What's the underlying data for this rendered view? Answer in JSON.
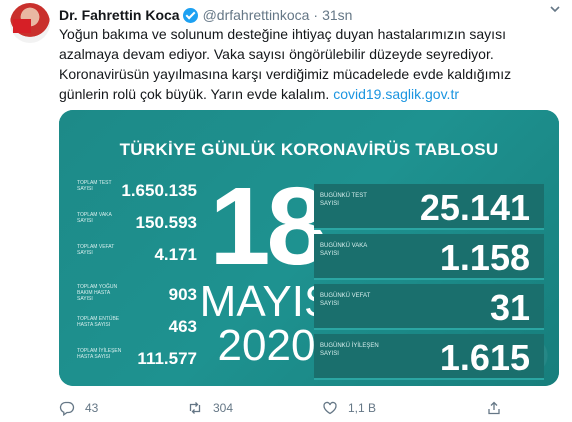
{
  "tweet": {
    "author_name": "Dr. Fahrettin Koca",
    "handle": "@drfahrettinkoca",
    "separator": "·",
    "time": "31sn",
    "text_lines": [
      "Yoğun bakıma ve solunum desteğine ihtiyaç duyan hastalarımızın sayısı",
      "azalmaya devam ediyor. Vaka sayısı öngörülebilir düzeyde seyrediyor.",
      "Koronavirüsün yayılmasına karşı verdiğimiz mücadelede evde kaldığımız",
      "günlerin rolü çok büyük. Yarın evde kalalım. "
    ],
    "link": "covid19.saglik.gov.tr"
  },
  "card": {
    "title": "TÜRKİYE GÜNLÜK KORONAVİRÜS TABLOSU",
    "day": "18",
    "month": "MAYIS",
    "year": "2020",
    "left_stats": [
      {
        "label": "TOPLAM TEST SAYISI",
        "value": "1.650.135"
      },
      {
        "label": "TOPLAM VAKA SAYISI",
        "value": "150.593"
      },
      {
        "label": "TOPLAM VEFAT SAYISI",
        "value": "4.171"
      },
      {
        "label": "TOPLAM YOĞUN BAKIM HASTA SAYISI",
        "value": "903"
      },
      {
        "label": "TOPLAM ENTÜBE HASTA SAYISI",
        "value": "463"
      },
      {
        "label": "TOPLAM İYİLEŞEN HASTA SAYISI",
        "value": "111.577"
      }
    ],
    "right_stats": [
      {
        "label": "BUGÜNKÜ TEST SAYISI",
        "value": "25.141"
      },
      {
        "label": "BUGÜNKÜ VAKA SAYISI",
        "value": "1.158"
      },
      {
        "label": "BUGÜNKÜ VEFAT SAYISI",
        "value": "31"
      },
      {
        "label": "BUGÜNKÜ İYİLEŞEN SAYISI",
        "value": "1.615"
      }
    ]
  },
  "actions": {
    "reply_icon": "reply-icon",
    "reply_count": "43",
    "retweet_icon": "retweet-icon",
    "retweet_count": "304",
    "like_icon": "heart-icon",
    "like_count": "1,1 B",
    "share_icon": "share-icon"
  },
  "colors": {
    "card_bg": "#1e8c8a",
    "link": "#1b95e0",
    "muted": "#657786",
    "verified": "#1da1f2"
  }
}
